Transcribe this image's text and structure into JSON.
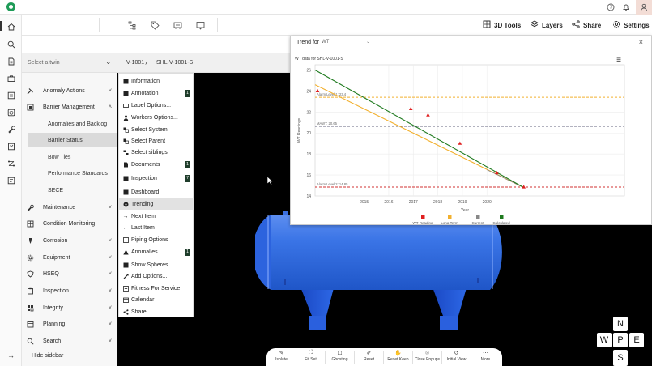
{
  "topbar": {
    "right_icons": [
      "help-icon",
      "bell-icon",
      "user-icon"
    ]
  },
  "rail": {
    "icons": [
      "home-icon",
      "search-icon",
      "document-icon",
      "briefcase-icon",
      "report-icon",
      "clock-icon",
      "wrench-icon",
      "bookmark-icon",
      "flow-icon",
      "list-icon"
    ]
  },
  "toolbar": {
    "tools_3d": "3D Tools",
    "layers": "Layers",
    "share": "Share",
    "settings": "Settings"
  },
  "twinbar": {
    "select_placeholder": "Select a twin",
    "crumb1": "V-1001",
    "crumb2": "SHL-V-1001-S"
  },
  "sidebar": {
    "items": [
      {
        "label": "Anomaly Actions",
        "chevron": "˅",
        "icon": "hammer-icon"
      },
      {
        "label": "Barrier Management",
        "chevron": "˄",
        "icon": "barrier-icon"
      },
      {
        "label": "Maintenance",
        "chevron": "˅",
        "icon": "wrench-icon"
      },
      {
        "label": "Condition Monitoring",
        "chevron": "˅",
        "icon": "monitor-icon"
      },
      {
        "label": "Corrosion",
        "chevron": "˅",
        "icon": "corrosion-icon"
      },
      {
        "label": "Equipment",
        "chevron": "˅",
        "icon": "gear-icon"
      },
      {
        "label": "HSEQ",
        "chevron": "˅",
        "icon": "shield-icon"
      },
      {
        "label": "Inspection",
        "chevron": "˅",
        "icon": "clipboard-icon"
      },
      {
        "label": "Integrity",
        "chevron": "˅",
        "icon": "grid-icon"
      },
      {
        "label": "Planning",
        "chevron": "˅",
        "icon": "calendar-icon"
      },
      {
        "label": "Search",
        "chevron": "˅",
        "icon": "search-icon"
      }
    ],
    "subitems": [
      {
        "label": "Anomalies and Backlog"
      },
      {
        "label": "Barrier Status"
      },
      {
        "label": "Bow Ties"
      },
      {
        "label": "Performance Standards"
      },
      {
        "label": "SECE"
      }
    ],
    "hide_label": "Hide sidebar"
  },
  "context_menu": {
    "items": [
      {
        "label": "Information",
        "badge": ""
      },
      {
        "label": "Annotation",
        "badge": "1"
      },
      {
        "label": "Label Options...",
        "badge": ""
      },
      {
        "label": "Workers Options...",
        "badge": ""
      },
      {
        "label": "Select System",
        "badge": ""
      },
      {
        "label": "Select Parent",
        "badge": ""
      },
      {
        "label": "Select siblings",
        "badge": ""
      },
      {
        "label": "Documents",
        "badge": "1"
      },
      {
        "label": "Inspection",
        "badge": "7"
      },
      {
        "label": "Dashboard",
        "badge": ""
      },
      {
        "label": "Trending",
        "badge": ""
      },
      {
        "label": "Next Item",
        "badge": ""
      },
      {
        "label": "Last Item",
        "badge": ""
      },
      {
        "label": "Piping Options",
        "badge": ""
      },
      {
        "label": "Anomalies",
        "badge": "1"
      },
      {
        "label": "Show Spheres",
        "badge": ""
      },
      {
        "label": "Add Options...",
        "badge": ""
      },
      {
        "label": "Fitness For Service",
        "badge": ""
      },
      {
        "label": "Calendar",
        "badge": ""
      },
      {
        "label": "Share",
        "badge": ""
      }
    ]
  },
  "trend": {
    "title": "Trend for",
    "select_value": "WT",
    "close": "×",
    "menu": "≡"
  },
  "chart_data": {
    "type": "line",
    "title": "WT data for SHL-V-1001-S",
    "xlabel": "Year",
    "ylabel": "WT Readings",
    "xlim": [
      2013.0,
      2025.6
    ],
    "ylim": [
      14,
      26.5
    ],
    "xticks": [
      "2015",
      "2016",
      "2017",
      "2018",
      "2019",
      "2020"
    ],
    "yticks": [
      "14",
      "16",
      "18",
      "20",
      "22",
      "24",
      "26"
    ],
    "grid": true,
    "legend_position": "bottom",
    "legend": [
      "WT Reading",
      "Long Term",
      "Current",
      "Calculated"
    ],
    "legend_colors": [
      "#e02020",
      "#f2b02e",
      "#888888",
      "#1f7a1f"
    ],
    "hlines": [
      {
        "label": "Alarm Level 1: 23.4",
        "value": 23.4,
        "color": "#f2b02e"
      },
      {
        "label": "MAWT: 20.65",
        "value": 20.65,
        "color": "#333355"
      },
      {
        "label": "Alarm Level 2: 14.85",
        "value": 14.85,
        "color": "#d03030"
      }
    ],
    "series": [
      {
        "name": "WT Reading",
        "points": [
          [
            2013.1,
            24.0
          ],
          [
            2016.9,
            22.3
          ],
          [
            2017.6,
            21.7
          ],
          [
            2018.9,
            19.0
          ],
          [
            2020.4,
            16.2
          ],
          [
            2021.5,
            14.85
          ]
        ]
      },
      {
        "name": "Long Term",
        "points": [
          [
            2013.0,
            24.6
          ],
          [
            2021.5,
            14.8
          ]
        ]
      },
      {
        "name": "Current",
        "points": [
          [
            2020.0,
            16.5
          ],
          [
            2021.5,
            14.8
          ]
        ]
      },
      {
        "name": "Calculated",
        "points": [
          [
            2013.0,
            26.0
          ],
          [
            2021.5,
            14.8
          ]
        ]
      }
    ]
  },
  "bottombar": {
    "buttons": [
      {
        "label": "Isolate",
        "icon": "isolate-icon"
      },
      {
        "label": "Fit Set",
        "icon": "fit-icon"
      },
      {
        "label": "Ghosting",
        "icon": "ghost-icon"
      },
      {
        "label": "Reset",
        "icon": "reset-icon"
      },
      {
        "label": "Reset Keep",
        "icon": "hand-icon"
      },
      {
        "label": "Close Popups",
        "icon": "close-popups-icon"
      },
      {
        "label": "Initial View",
        "icon": "initial-view-icon"
      },
      {
        "label": "More",
        "icon": "more-icon"
      }
    ]
  },
  "compass": {
    "n": "N",
    "w": "W",
    "p": "P",
    "e": "E",
    "s": "S"
  },
  "colors": {
    "vessel": "#2f6fe0",
    "support": "#1c4fd8",
    "background": "#000000"
  }
}
